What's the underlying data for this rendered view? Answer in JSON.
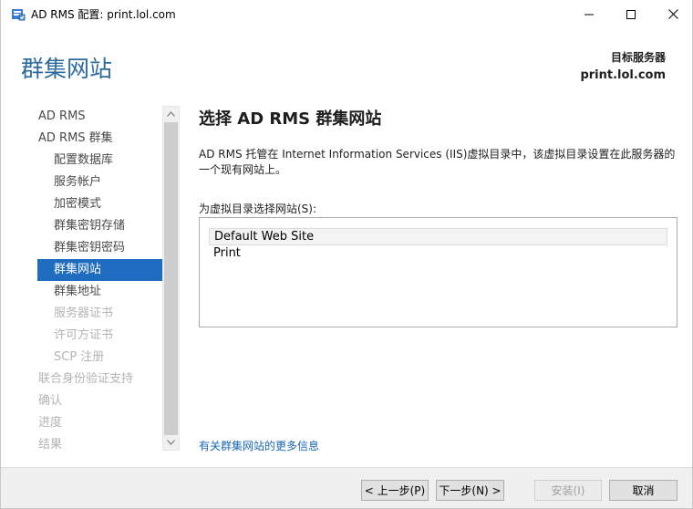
{
  "window": {
    "title": "AD RMS 配置: print.lol.com",
    "minimize_icon": "minimize-icon",
    "maximize_icon": "maximize-icon",
    "close_icon": "close-icon"
  },
  "header": {
    "page_title": "群集网站",
    "target_label": "目标服务器",
    "target_value": "print.lol.com"
  },
  "nav": {
    "items": [
      {
        "label": "AD RMS",
        "level": 1,
        "state": "normal"
      },
      {
        "label": "AD RMS 群集",
        "level": 1,
        "state": "normal"
      },
      {
        "label": "配置数据库",
        "level": 2,
        "state": "normal"
      },
      {
        "label": "服务帐户",
        "level": 2,
        "state": "normal"
      },
      {
        "label": "加密模式",
        "level": 2,
        "state": "normal"
      },
      {
        "label": "群集密钥存储",
        "level": 2,
        "state": "normal"
      },
      {
        "label": "群集密钥密码",
        "level": 2,
        "state": "normal"
      },
      {
        "label": "群集网站",
        "level": 2,
        "state": "selected"
      },
      {
        "label": "群集地址",
        "level": 2,
        "state": "normal"
      },
      {
        "label": "服务器证书",
        "level": 2,
        "state": "disabled"
      },
      {
        "label": "许可方证书",
        "level": 2,
        "state": "disabled"
      },
      {
        "label": "SCP 注册",
        "level": 2,
        "state": "disabled"
      },
      {
        "label": "联合身份验证支持",
        "level": 1,
        "state": "disabled"
      },
      {
        "label": "确认",
        "level": 1,
        "state": "disabled"
      },
      {
        "label": "进度",
        "level": 1,
        "state": "disabled"
      },
      {
        "label": "结果",
        "level": 1,
        "state": "disabled"
      }
    ]
  },
  "main": {
    "heading": "选择 AD RMS 群集网站",
    "description": "AD RMS 托管在 Internet Information Services (IIS)虚拟目录中，该虚拟目录设置在此服务器的一个现有网站上。",
    "list_label": "为虚拟目录选择网站(S):",
    "websites": [
      "Default Web Site",
      "Print"
    ],
    "selected_website": "Default Web Site",
    "more_info_link": "有关群集网站的更多信息"
  },
  "footer": {
    "prev_label": "< 上一步(P)",
    "next_label": "下一步(N) >",
    "install_label": "安装(I)",
    "cancel_label": "取消"
  },
  "colors": {
    "title_accent": "#2b6a9e",
    "selection": "#1f6cc0",
    "link": "#1a66b5"
  }
}
